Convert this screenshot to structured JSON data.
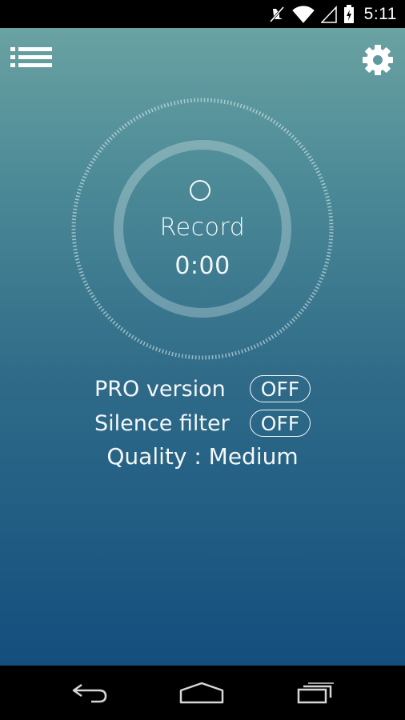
{
  "status_bar": {
    "time": "5:11",
    "icons": [
      "mute-icon",
      "wifi-icon",
      "signal-icon",
      "battery-charging-icon"
    ]
  },
  "toolbar": {
    "menu_icon": "list-menu-icon",
    "settings_icon": "gear-icon"
  },
  "recorder": {
    "label": "Record",
    "timer": "0:00"
  },
  "options": {
    "pro_version": {
      "label": "PRO version",
      "state": "OFF"
    },
    "silence_filter": {
      "label": "Silence filter",
      "state": "OFF"
    },
    "quality": "Quality : Medium"
  },
  "nav_bar": {
    "icons": [
      "back-icon",
      "home-icon",
      "recent-apps-icon"
    ]
  },
  "colors": {
    "gradient_top": "#6aa2a2",
    "gradient_bottom": "#134e7e",
    "foreground": "#f3f7f8",
    "system_bar": "#000000"
  }
}
